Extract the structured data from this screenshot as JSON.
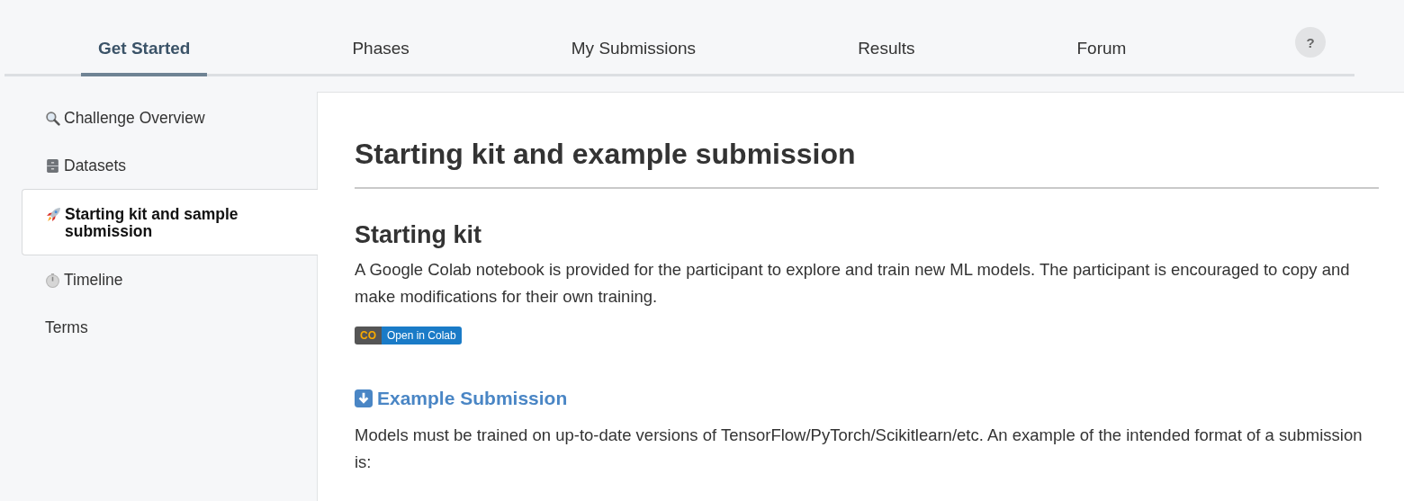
{
  "tabs": [
    {
      "label": "Get Started",
      "selected": true
    },
    {
      "label": "Phases",
      "selected": false
    },
    {
      "label": "My Submissions",
      "selected": false
    },
    {
      "label": "Results",
      "selected": false
    },
    {
      "label": "Forum",
      "selected": false
    }
  ],
  "help_button": {
    "label": "?"
  },
  "sidebar": {
    "items": [
      {
        "label": "Challenge Overview",
        "selected": false
      },
      {
        "label": "Datasets",
        "selected": false
      },
      {
        "label": "Starting kit and sample submission",
        "selected": true
      },
      {
        "label": "Timeline",
        "selected": false
      },
      {
        "label": "Terms",
        "selected": false
      }
    ]
  },
  "content": {
    "title": "Starting kit and example submission",
    "section_title": "Starting kit",
    "paragraph_1": "A Google Colab notebook is provided for the participant to explore and train new ML models. The participant is encouraged to copy and make modifications for their own training.",
    "colab_badge": {
      "logo": "CO",
      "label": "Open in Colab"
    },
    "subsection_link": "Example Submission",
    "paragraph_2": "Models must be trained on up-to-date versions of TensorFlow/PyTorch/Scikitlearn/etc. An example of the intended format of a submission is:"
  }
}
